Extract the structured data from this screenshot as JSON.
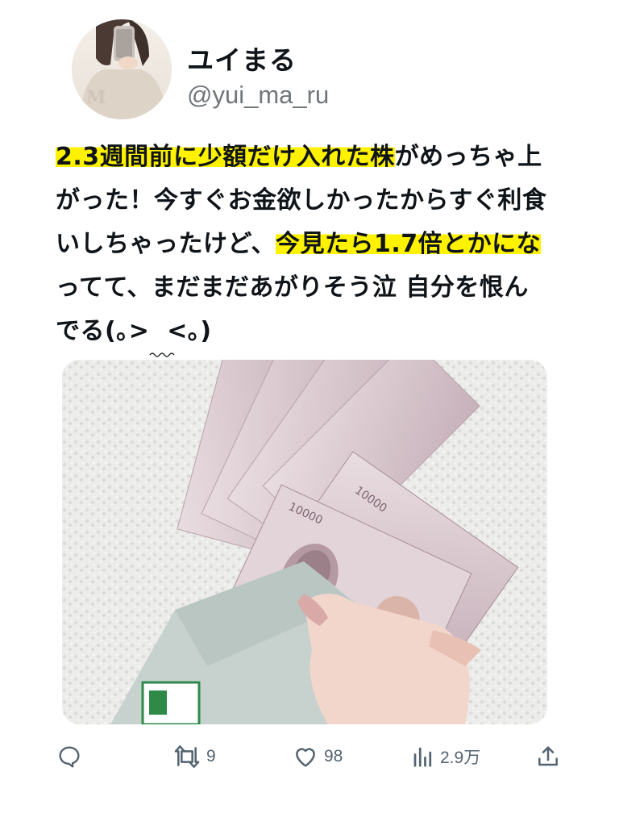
{
  "author": {
    "display_name": "ユイまる",
    "handle": "@yui_ma_ru"
  },
  "tweet": {
    "segments": [
      "2.3週間前に少額だけ入れた株",
      "がめっちゃ上",
      "がった！今すぐお金欲しかったからすぐ利食",
      "いしちゃったけど、",
      "今見たら1.7倍とかにな",
      "ってて、まだまだあがりそう泣 自分を恨ん",
      "でる(",
      "｡>",
      "  ",
      "<｡)"
    ]
  },
  "actions": {
    "reply": {
      "icon": "reply-icon",
      "count": ""
    },
    "retweet": {
      "icon": "retweet-icon",
      "count": "9"
    },
    "like": {
      "icon": "heart-icon",
      "count": "98"
    },
    "views": {
      "icon": "views-chart-icon",
      "count": "2.9万"
    },
    "share": {
      "icon": "share-icon",
      "count": ""
    }
  },
  "colors": {
    "highlight": "#fff200",
    "muted": "#536471",
    "handle": "#71767b"
  }
}
